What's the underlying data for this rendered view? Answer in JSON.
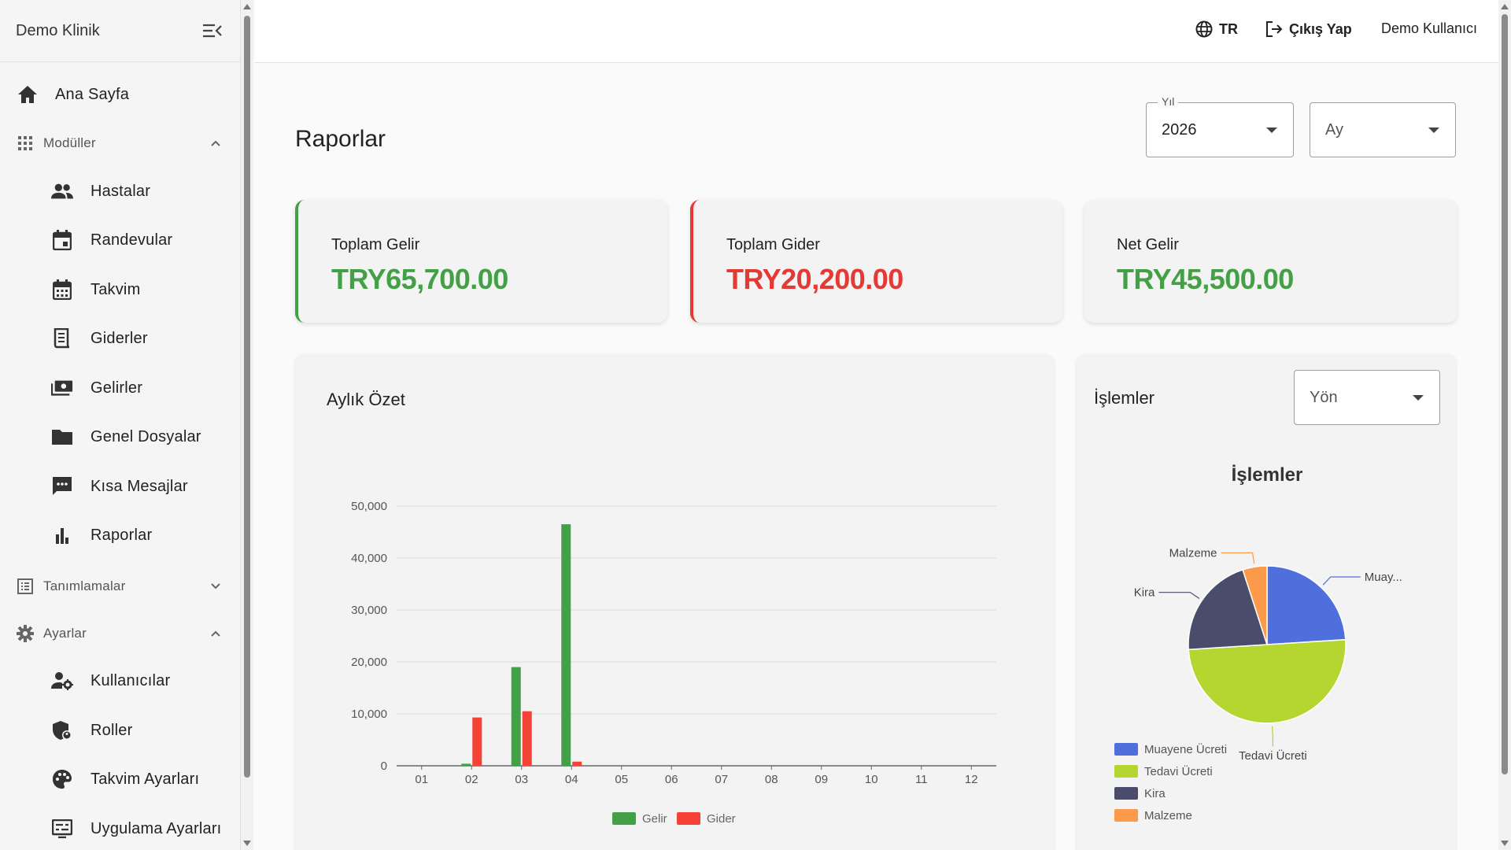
{
  "app": {
    "name": "Demo Klinik"
  },
  "sidebar": {
    "home": "Ana Sayfa",
    "modules": {
      "label": "Modüller",
      "items": [
        "Hastalar",
        "Randevular",
        "Takvim",
        "Giderler",
        "Gelirler",
        "Genel Dosyalar",
        "Kısa Mesajlar",
        "Raporlar"
      ]
    },
    "definitions": {
      "label": "Tanımlamalar"
    },
    "settings": {
      "label": "Ayarlar",
      "items": [
        "Kullanıcılar",
        "Roller",
        "Takvim Ayarları",
        "Uygulama Ayarları"
      ]
    }
  },
  "topbar": {
    "language": "TR",
    "logout": "Çıkış Yap",
    "user": "Demo Kullanıcı"
  },
  "page": {
    "title": "Raporlar",
    "year_filter": {
      "label": "Yıl",
      "value": "2026"
    },
    "month_filter": {
      "placeholder": "Ay"
    }
  },
  "summary": {
    "income": {
      "label": "Toplam Gelir",
      "value": "TRY65,700.00"
    },
    "expense": {
      "label": "Toplam Gider",
      "value": "TRY20,200.00"
    },
    "net": {
      "label": "Net Gelir",
      "value": "TRY45,500.00"
    }
  },
  "monthly": {
    "title": "Aylık Özet"
  },
  "transactions": {
    "title": "İşlemler",
    "direction_placeholder": "Yön",
    "chart_title": "İşlemler"
  },
  "colors": {
    "income": "#43a047",
    "expense": "#f44336",
    "muayene": "#4e6fdc",
    "tedavi": "#b5d631",
    "kira": "#4a4c6c",
    "malzeme": "#fb9a4a"
  },
  "chart_data": [
    {
      "type": "bar",
      "title": "Aylık Özet",
      "categories": [
        "01",
        "02",
        "03",
        "04",
        "05",
        "06",
        "07",
        "08",
        "09",
        "10",
        "11",
        "12"
      ],
      "series": [
        {
          "name": "Gelir",
          "values": [
            0,
            400,
            19000,
            46500,
            0,
            0,
            0,
            0,
            0,
            0,
            0,
            0
          ]
        },
        {
          "name": "Gider",
          "values": [
            0,
            9300,
            10500,
            800,
            0,
            0,
            0,
            0,
            0,
            0,
            0,
            0
          ]
        }
      ],
      "yticks": [
        "0",
        "10,000",
        "20,000",
        "30,000",
        "40,000",
        "50,000"
      ],
      "ylim": [
        0,
        50000
      ],
      "grid": true,
      "legend": "bottom"
    },
    {
      "type": "pie",
      "title": "İşlemler",
      "slices": [
        {
          "label": "Muayene Ücreti",
          "short": "Muay...",
          "value": 24
        },
        {
          "label": "Tedavi Ücreti",
          "value": 50
        },
        {
          "label": "Kira",
          "value": 21
        },
        {
          "label": "Malzeme",
          "value": 5
        }
      ],
      "legend": "bottom-left"
    }
  ]
}
